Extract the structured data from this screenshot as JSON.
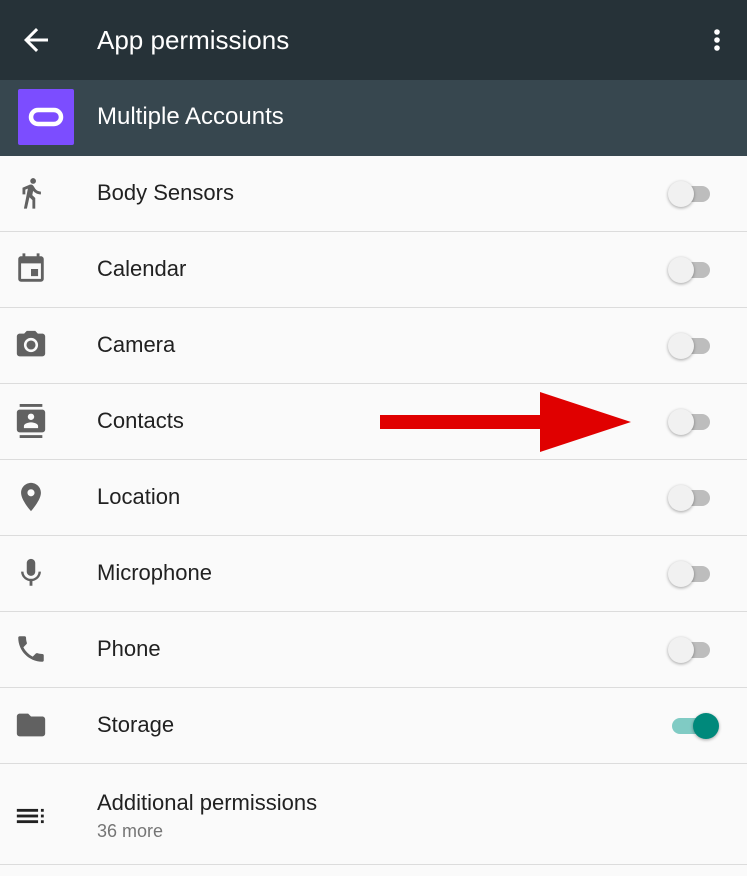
{
  "toolbar": {
    "title": "App permissions"
  },
  "app": {
    "name": "Multiple Accounts"
  },
  "permissions": [
    {
      "label": "Body Sensors",
      "icon": "walk-icon",
      "enabled": false
    },
    {
      "label": "Calendar",
      "icon": "calendar-icon",
      "enabled": false
    },
    {
      "label": "Camera",
      "icon": "camera-icon",
      "enabled": false
    },
    {
      "label": "Contacts",
      "icon": "contacts-icon",
      "enabled": false
    },
    {
      "label": "Location",
      "icon": "location-pin-icon",
      "enabled": false
    },
    {
      "label": "Microphone",
      "icon": "microphone-icon",
      "enabled": false
    },
    {
      "label": "Phone",
      "icon": "phone-icon",
      "enabled": false
    },
    {
      "label": "Storage",
      "icon": "folder-icon",
      "enabled": true
    }
  ],
  "additional": {
    "label": "Additional permissions",
    "sub": "36 more"
  },
  "colors": {
    "toolbar": "#263238",
    "appbar": "#37474f",
    "accent": "#00897b",
    "app_icon": "#7c4dff",
    "annotation_arrow": "#e00000"
  }
}
